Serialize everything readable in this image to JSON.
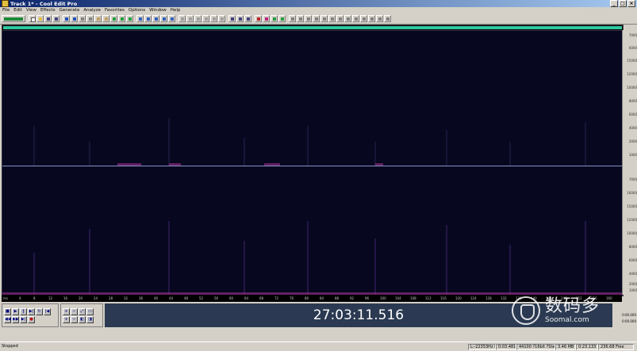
{
  "window": {
    "title": "Track 1* - Cool Edit Pro"
  },
  "menu": [
    "File",
    "Edit",
    "View",
    "Effects",
    "Generate",
    "Analyze",
    "Favorites",
    "Options",
    "Window",
    "Help"
  ],
  "time_display": "27:03:11.516",
  "selection_info": {
    "begin": "0:00.000",
    "end": "0:00.000"
  },
  "status": {
    "state": "Stopped",
    "level": "L:-22353Hz R",
    "pos": "0:03.481",
    "format": "44100 ?16bit ?Stereo",
    "size": "3.46 MB",
    "duration": "0:23.133",
    "free": "236.68 Free"
  },
  "amplitude_ruler": [
    "7000",
    "6000",
    "15000",
    "12000",
    "10000",
    "8000",
    "6000",
    "4000",
    "2000",
    "1000",
    "7000",
    "16000",
    "15000",
    "12000",
    "10000",
    "8000",
    "6000",
    "4000",
    "2000",
    "1000"
  ],
  "time_ruler": [
    "ms",
    "4",
    "8",
    "12",
    "16",
    "20",
    "24",
    "28",
    "32",
    "36",
    "40",
    "44",
    "48",
    "52",
    "56",
    "60",
    "64",
    "68",
    "72",
    "76",
    "80",
    "84",
    "88",
    "92",
    "96",
    "100",
    "104",
    "108",
    "112",
    "116",
    "120",
    "124",
    "128",
    "132",
    "136",
    "140",
    "144",
    "148",
    "152",
    "156",
    "160"
  ],
  "watermark": {
    "cn": "数码多",
    "url": "Soomal.com"
  },
  "colors": {
    "waveform_bg": "#07081f",
    "overview_sel": "#30c8a0",
    "time_bg": "#2b3a52"
  }
}
